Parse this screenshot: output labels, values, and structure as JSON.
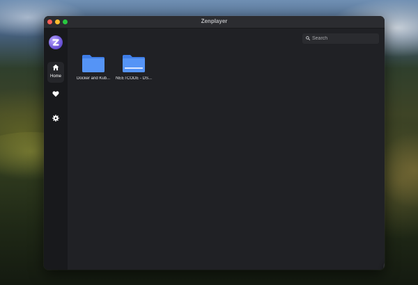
{
  "window": {
    "title": "Zenplayer"
  },
  "sidebar": {
    "logo_icon": "zenplayer-logo-icon",
    "items": [
      {
        "id": "home",
        "icon": "home-icon",
        "label": "Home",
        "active": true
      },
      {
        "id": "favorites",
        "icon": "heart-icon",
        "label": ""
      },
      {
        "id": "settings",
        "icon": "gear-icon",
        "label": ""
      }
    ]
  },
  "search": {
    "placeholder": "Search",
    "value": ""
  },
  "folders": [
    {
      "label": "Docker and Kub...",
      "icon": "folder-icon"
    },
    {
      "label": "NEETCODE - DS...",
      "icon": "folder-icon"
    }
  ],
  "fab": {
    "icon": "plus-icon"
  },
  "colors": {
    "window_bg": "#202125",
    "sidebar_bg": "#18191c",
    "folder_blue": "#4f8ef5",
    "accent_purple": "#6f57d8"
  }
}
